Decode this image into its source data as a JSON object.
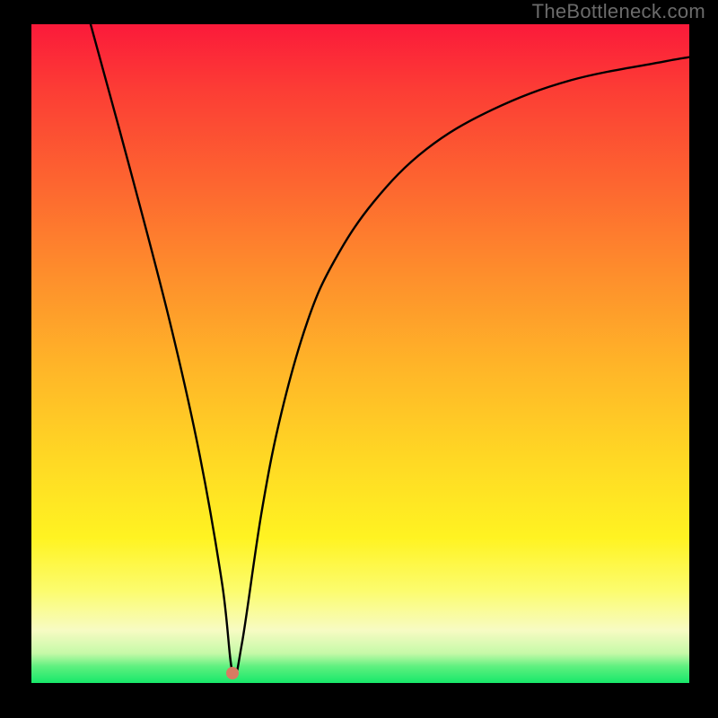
{
  "watermark": "TheBottleneck.com",
  "colors": {
    "background_frame": "#000000",
    "gradient_top": "#fb1a3a",
    "gradient_bottom": "#17e86a",
    "curve_stroke": "#000000",
    "marker_fill": "#d77b62"
  },
  "chart_data": {
    "type": "line",
    "title": "",
    "xlabel": "",
    "ylabel": "",
    "xlim": [
      0,
      100
    ],
    "ylim": [
      0,
      100
    ],
    "grid": false,
    "legend": false,
    "series": [
      {
        "name": "curve",
        "x": [
          9,
          15,
          21,
          25.5,
          29,
          30.6,
          32,
          35,
          38,
          42,
          46,
          52,
          60,
          70,
          82,
          96,
          100
        ],
        "y": [
          100,
          78,
          55,
          35,
          15,
          1.5,
          6,
          26,
          41,
          55,
          64,
          73,
          81,
          87,
          91.5,
          94.3,
          95
        ]
      }
    ],
    "marker": {
      "x": 30.6,
      "y": 1.5
    },
    "notes": "y is a relative bottleneck / mismatch metric (0 = best, 100 = worst). Values estimated from pixel positions; no axis tick labels are present in the image."
  }
}
